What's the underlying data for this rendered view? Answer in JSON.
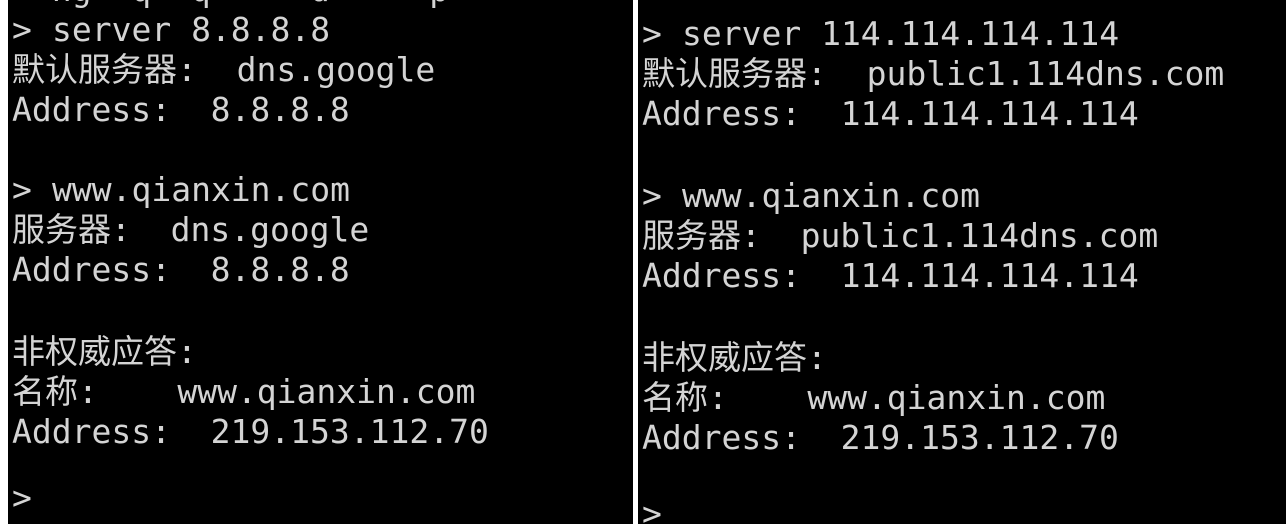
{
  "left": {
    "top_fragment": "  ng  q  q     d     p",
    "prompt_glyph": ">",
    "lines": [
      {
        "prompt": true,
        "text": "server 8.8.8.8"
      },
      {
        "prompt": false,
        "text": "默认服务器:  dns.google"
      },
      {
        "prompt": false,
        "text": "Address:  8.8.8.8"
      },
      {
        "prompt": true,
        "text": "www.qianxin.com"
      },
      {
        "prompt": false,
        "text": "服务器:  dns.google"
      },
      {
        "prompt": false,
        "text": "Address:  8.8.8.8"
      },
      {
        "prompt": false,
        "text": "非权威应答:"
      },
      {
        "prompt": false,
        "text": "名称:    www.qianxin.com"
      },
      {
        "prompt": false,
        "text": "Address:  219.153.112.70"
      }
    ]
  },
  "right": {
    "prompt_glyph": ">",
    "lines": [
      {
        "prompt": true,
        "text": "server 114.114.114.114"
      },
      {
        "prompt": false,
        "text": "默认服务器:  public1.114dns.com"
      },
      {
        "prompt": false,
        "text": "Address:  114.114.114.114"
      },
      {
        "prompt": true,
        "text": "www.qianxin.com"
      },
      {
        "prompt": false,
        "text": "服务器:  public1.114dns.com"
      },
      {
        "prompt": false,
        "text": "Address:  114.114.114.114"
      },
      {
        "prompt": false,
        "text": "非权威应答:"
      },
      {
        "prompt": false,
        "text": "名称:    www.qianxin.com"
      },
      {
        "prompt": false,
        "text": "Address:  219.153.112.70"
      }
    ]
  }
}
